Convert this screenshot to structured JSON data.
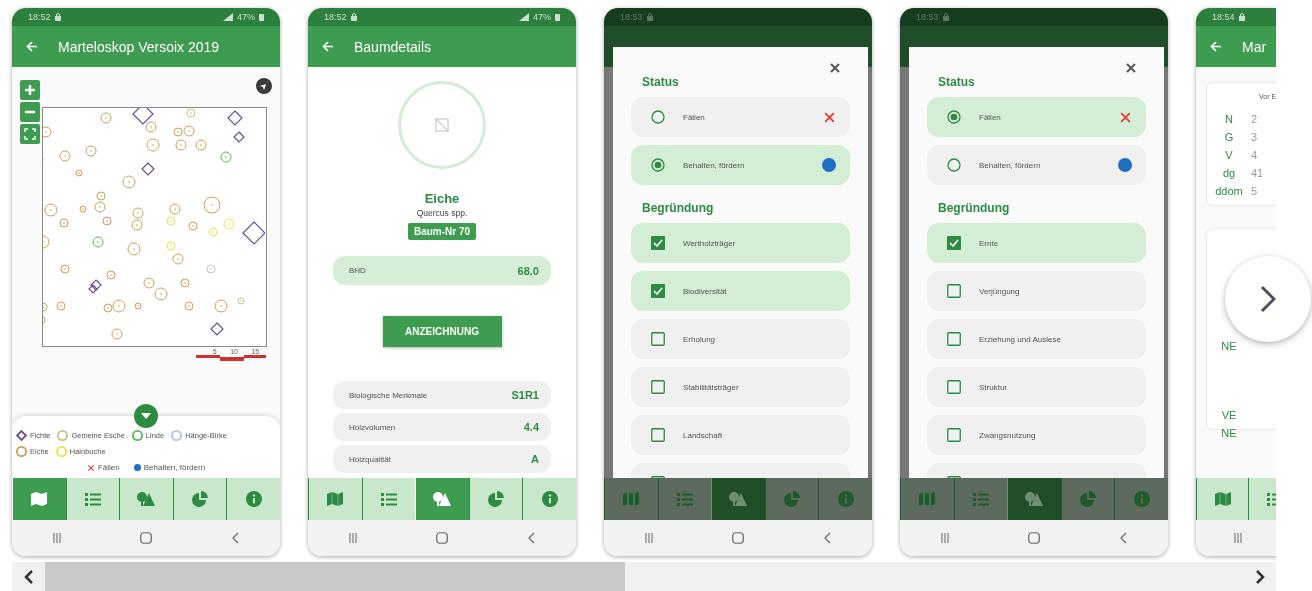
{
  "screenshots": [
    {
      "kind": "map",
      "time": "18:52",
      "battery": "47%",
      "title": "Marteloskop Versoix 2019",
      "scale_labels": [
        "5",
        "10",
        "15"
      ],
      "legend": [
        {
          "label": "Fichte",
          "kind": "diamond",
          "color": "#6b4f8f"
        },
        {
          "label": "Gemeine Esche",
          "kind": "circle",
          "color": "#c9c28a"
        },
        {
          "label": "Linde",
          "kind": "circle",
          "color": "#5cb85c"
        },
        {
          "label": "Hänge-Birke",
          "kind": "circle",
          "color": "#b4c6d8"
        },
        {
          "label": "Eiche",
          "kind": "circle",
          "color": "#c9a257"
        },
        {
          "label": "Hainbuche",
          "kind": "circle",
          "color": "#ece24e"
        }
      ],
      "status_legend": [
        {
          "label": "Fällen",
          "kind": "cross",
          "color": "#e53935"
        },
        {
          "label": "Behalten, fördern",
          "kind": "dot",
          "color": "#1e6fc0"
        }
      ],
      "nav": [
        {
          "selected": true
        },
        {
          "selected": false
        },
        {
          "selected": false
        },
        {
          "selected": false
        },
        {
          "selected": false
        }
      ]
    },
    {
      "kind": "details",
      "time": "18:52",
      "battery": "47%",
      "title": "Baumdetails",
      "species": "Eiche",
      "latin": "Quercus spp.",
      "badge": "Baum-Nr 70",
      "highlight": {
        "label": "BHD",
        "value": "68.0"
      },
      "button": "ANZEICHNUNG",
      "properties": [
        {
          "label": "Biologische Merkmale",
          "value": "S1R1"
        },
        {
          "label": "Holzvolumen",
          "value": "4.4"
        },
        {
          "label": "Holzqualität",
          "value": "A"
        }
      ],
      "nav": [
        {
          "selected": false
        },
        {
          "selected": false
        },
        {
          "selected": true
        },
        {
          "selected": false
        },
        {
          "selected": false
        }
      ]
    },
    {
      "kind": "dialog",
      "time": "18:53",
      "status_heading": "Status",
      "status_options": [
        {
          "label": "Fällen",
          "kind": "cross",
          "color": "#e53935",
          "selected": false
        },
        {
          "label": "Behalten, fördern",
          "kind": "dot",
          "color": "#1e6fc0",
          "selected": true
        }
      ],
      "reasons_heading": "Begründung",
      "reasons": [
        {
          "label": "Wertholzträger",
          "checked": true
        },
        {
          "label": "Biodiversität",
          "checked": true
        },
        {
          "label": "Erholung",
          "checked": false
        },
        {
          "label": "Stabilitätsträger",
          "checked": false
        },
        {
          "label": "Landschaft",
          "checked": false
        },
        {
          "checked": false
        }
      ],
      "nav": [
        {
          "selected": false
        },
        {
          "selected": false
        },
        {
          "selected": true
        },
        {
          "selected": false
        },
        {
          "selected": false
        }
      ]
    },
    {
      "kind": "dialog",
      "time": "18:53",
      "status_heading": "Status",
      "status_options": [
        {
          "label": "Fällen",
          "kind": "cross",
          "color": "#e53935",
          "selected": true
        },
        {
          "label": "Behalten, fördern",
          "kind": "dot",
          "color": "#1e6fc0",
          "selected": false
        }
      ],
      "reasons_heading": "Begründung",
      "reasons": [
        {
          "label": "Ernte",
          "checked": true
        },
        {
          "label": "Verjüngung",
          "checked": false
        },
        {
          "label": "Erziehung und Auslese",
          "checked": false
        },
        {
          "label": "Struktur",
          "checked": false
        },
        {
          "label": "Zwangsnutzung",
          "checked": false
        },
        {
          "checked": false
        }
      ],
      "nav": [
        {
          "selected": false
        },
        {
          "selected": false
        },
        {
          "selected": true
        },
        {
          "selected": false
        },
        {
          "selected": false
        }
      ]
    },
    {
      "kind": "stats",
      "time": "18:54",
      "title": "Mar",
      "column_header": "Vor E",
      "rows": [
        {
          "label": "N",
          "value": "2"
        },
        {
          "label": "G",
          "value": "3"
        },
        {
          "label": "V",
          "value": "4"
        },
        {
          "label": "dg",
          "value": "41"
        },
        {
          "label": "ddom",
          "value": "5"
        }
      ],
      "rows_2": [
        {
          "label": "NE"
        },
        {
          "label": "VE"
        },
        {
          "label": "NE"
        }
      ],
      "nav": [
        {
          "selected": false
        },
        {
          "selected": false
        }
      ]
    }
  ]
}
